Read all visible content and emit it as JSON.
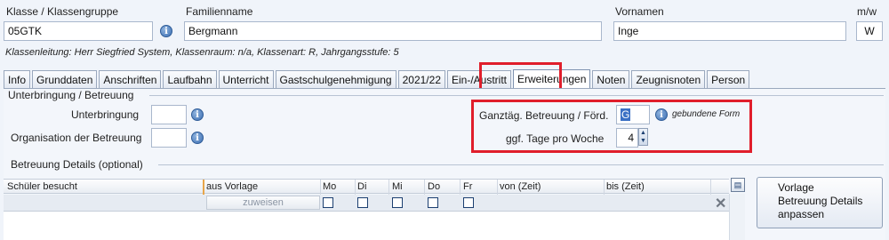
{
  "header": {
    "klasse_label": "Klasse / Klassengruppe",
    "klasse_value": "05GTK",
    "familienname_label": "Familienname",
    "familienname_value": "Bergmann",
    "vornamen_label": "Vornamen",
    "vornamen_value": "Inge",
    "mw_label": "m/w",
    "mw_value": "W",
    "info_line": "Klassenleitung: Herr Siegfried System, Klassenraum: n/a, Klassenart: R, Jahrgangsstufe: 5"
  },
  "tabs": [
    {
      "label": "Info"
    },
    {
      "label": "Grunddaten"
    },
    {
      "label": "Anschriften"
    },
    {
      "label": "Laufbahn"
    },
    {
      "label": "Unterricht"
    },
    {
      "label": "Gastschulgenehmigung"
    },
    {
      "label": "2021/22"
    },
    {
      "label": "Ein-/Austritt"
    },
    {
      "label": "Erweiterungen",
      "active": true
    },
    {
      "label": "Noten"
    },
    {
      "label": "Zeugnisnoten"
    },
    {
      "label": "Person"
    }
  ],
  "unterbringung": {
    "group_title": "Unterbringung / Betreuung",
    "unterbringung_label": "Unterbringung",
    "unterbringung_value": "",
    "organisation_label": "Organisation der Betreuung",
    "organisation_value": "",
    "ganztag_label": "Ganztäg. Betreuung / Förd.",
    "ganztag_value": "G",
    "ganztag_hint": "gebundene Form",
    "tage_label": "ggf. Tage pro Woche",
    "tage_value": "4"
  },
  "details": {
    "group_title": "Betreuung Details (optional)",
    "columns": [
      "Schüler besucht",
      "aus Vorlage",
      "Mo",
      "Di",
      "Mi",
      "Do",
      "Fr",
      "von (Zeit)",
      "bis (Zeit)"
    ],
    "row": {
      "zuweisen_label": "zuweisen",
      "mo": false,
      "di": false,
      "mi": false,
      "do": false,
      "fr": false
    },
    "vorlage_button_lines": [
      "Vorlage",
      "Betreuung Details",
      "anpassen"
    ]
  },
  "colors": {
    "highlight": "#e01e2b",
    "background": "#f0f4fa",
    "selection": "#3a6fc4"
  },
  "icons": [
    "info-icon",
    "column-chooser-icon",
    "delete-icon"
  ]
}
